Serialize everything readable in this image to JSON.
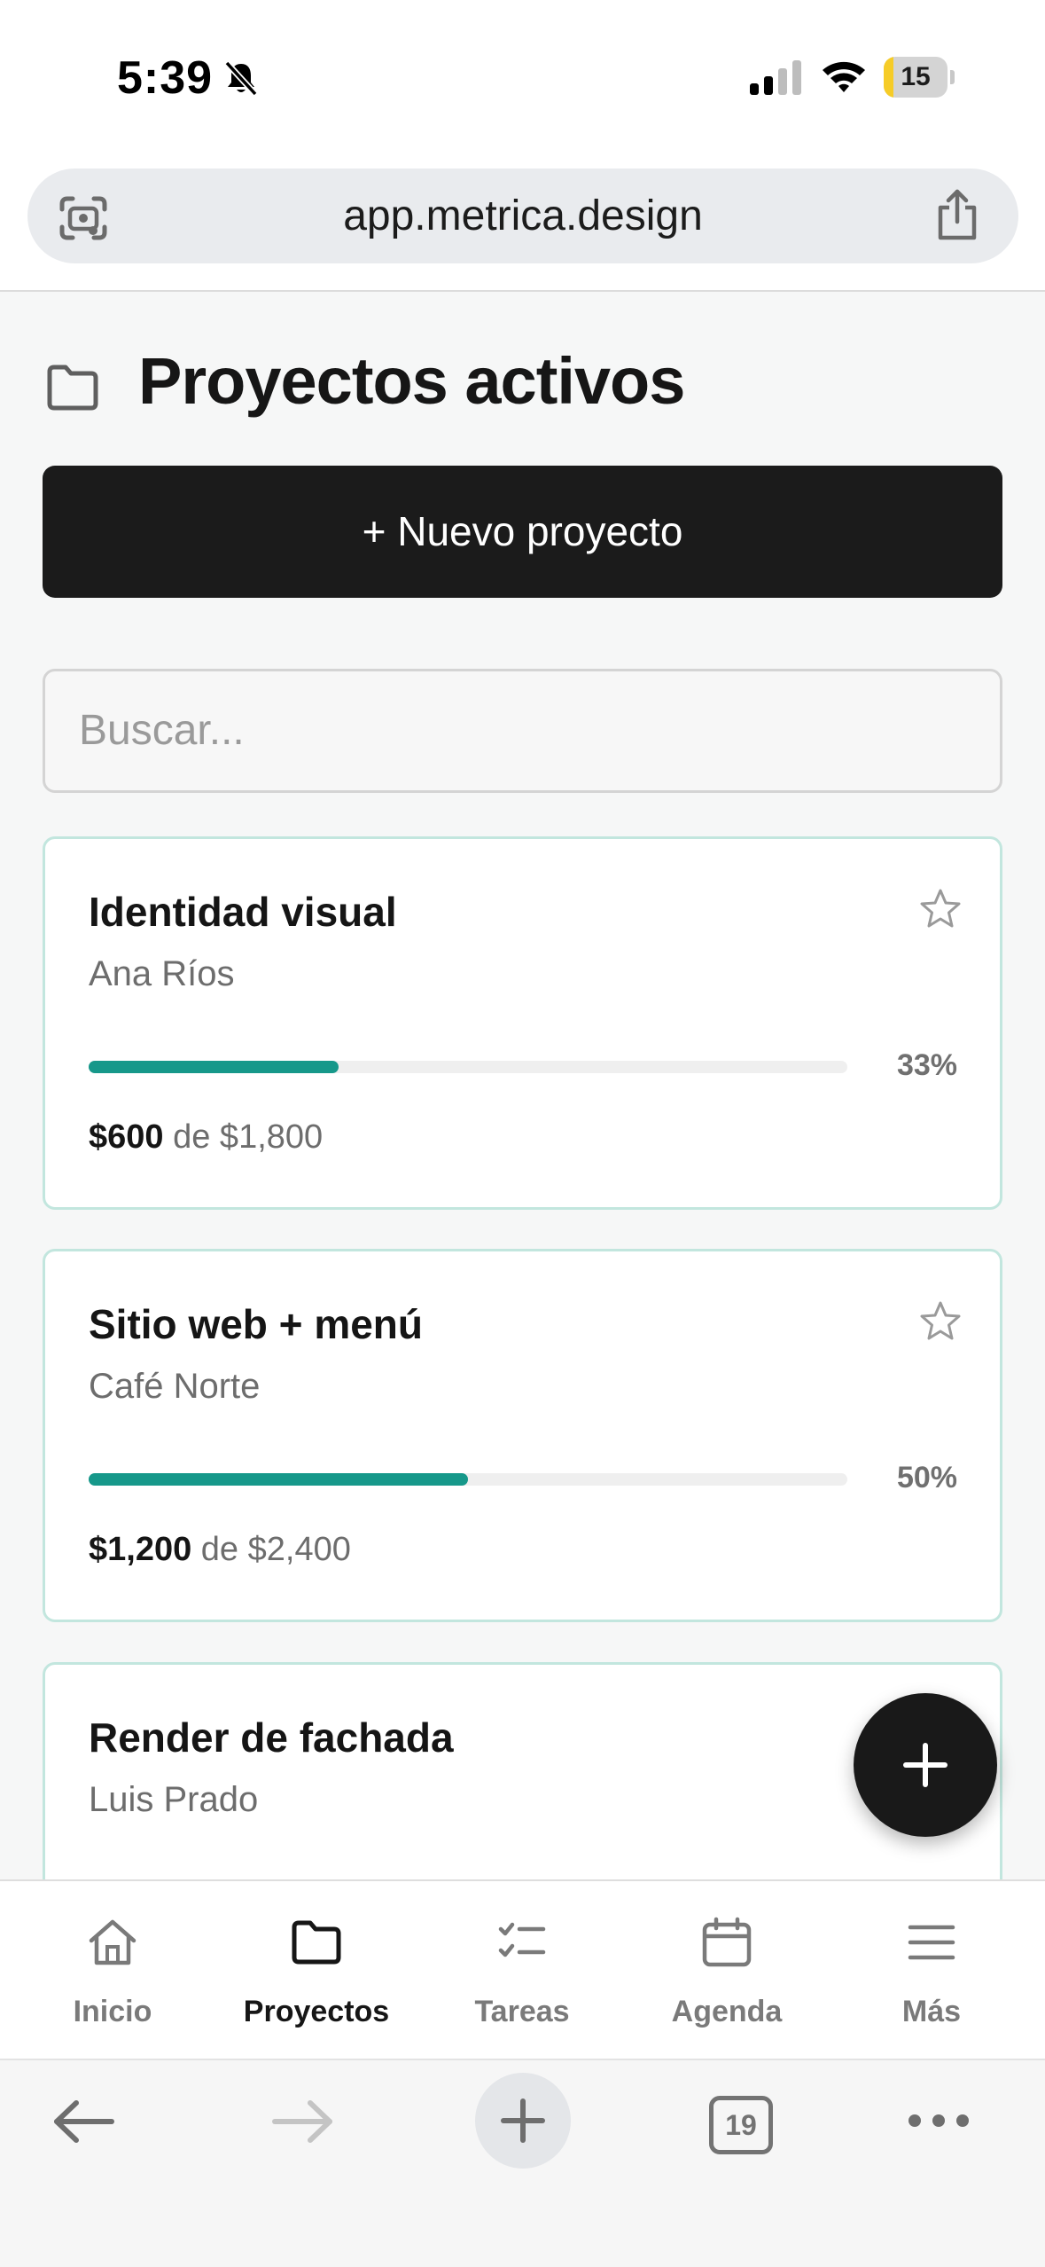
{
  "status_bar": {
    "time": "5:39",
    "battery_level": "15",
    "battery_fraction": 0.15
  },
  "browser": {
    "url": "app.metrica.design",
    "tabs_count": "19"
  },
  "page": {
    "title": "Proyectos activos",
    "new_project_label": "+ Nuevo proyecto",
    "search_placeholder": "Buscar..."
  },
  "projects": [
    {
      "title": "Identidad visual",
      "client": "Ana Ríos",
      "progress": 0.33,
      "percent_label": "33%",
      "paid": "$600",
      "of_label": "de $1,800"
    },
    {
      "title": "Sitio web + menú",
      "client": "Café Norte",
      "progress": 0.5,
      "percent_label": "50%",
      "paid": "$1,200",
      "of_label": "de $2,400"
    },
    {
      "title": "Render de fachada",
      "client": "Luis Prado"
    }
  ],
  "tab_bar": {
    "items": [
      {
        "label": "Inicio",
        "icon": "home-icon"
      },
      {
        "label": "Proyectos",
        "icon": "folder-icon",
        "active": true
      },
      {
        "label": "Tareas",
        "icon": "checklist-icon"
      },
      {
        "label": "Agenda",
        "icon": "calendar-icon"
      },
      {
        "label": "Más",
        "icon": "menu-icon"
      }
    ]
  },
  "colors": {
    "accent": "#16988a",
    "card_border": "#c2e6de",
    "primary_button": "#1b1b1b",
    "battery": "#f6cc27"
  }
}
